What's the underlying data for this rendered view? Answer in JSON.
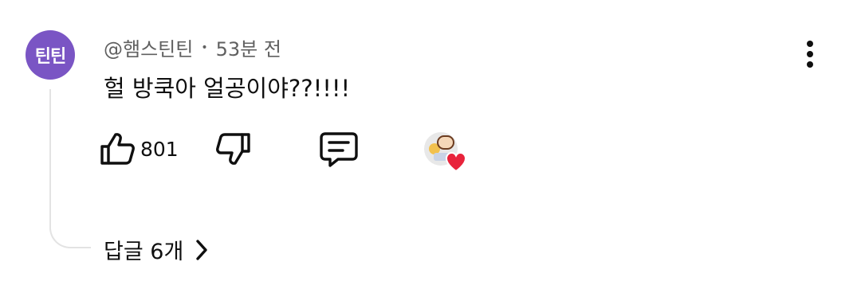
{
  "comment": {
    "avatar_initials": "틴틴",
    "avatar_color": "#7a55c4",
    "author": "@햄스틴틴",
    "separator": "•",
    "time_ago": "53분 전",
    "text": "헐 방쿡아 얼공이야??!!!!",
    "like_count": "801",
    "replies_label": "답글 6개"
  },
  "icons": {
    "like": "thumbs-up-icon",
    "dislike": "thumbs-down-icon",
    "reply": "comment-icon",
    "more": "kebab-menu-icon",
    "creator_heart": "heart-icon",
    "chevron": "chevron-right-icon"
  },
  "colors": {
    "heart": "#e8233b",
    "meta_text": "#606060",
    "thread_line": "#e3e3e3"
  }
}
